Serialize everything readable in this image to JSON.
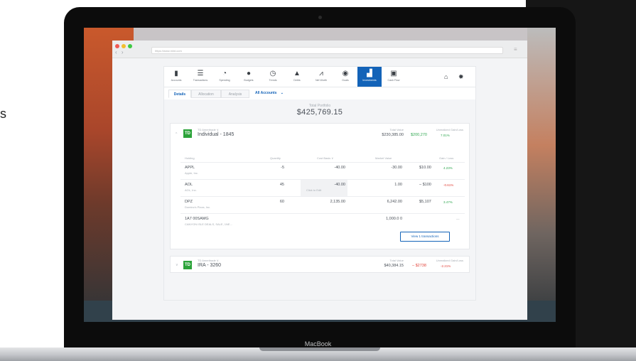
{
  "side_text": "s",
  "device_label": "MacBook",
  "browser": {
    "url": "https://www.mint.com",
    "back_glyph": "‹",
    "forward_glyph": "›",
    "menu_glyph": "≡"
  },
  "nav": {
    "items": [
      {
        "label": "Accounts",
        "icon": "wallet-icon",
        "glyph": "▮"
      },
      {
        "label": "Transactions",
        "icon": "list-icon",
        "glyph": "☰"
      },
      {
        "label": "Spending",
        "icon": "pie-icon",
        "glyph": "◔"
      },
      {
        "label": "Budgets",
        "icon": "coins-icon",
        "glyph": "●"
      },
      {
        "label": "Trends",
        "icon": "clock-icon",
        "glyph": "◷"
      },
      {
        "label": "Debts",
        "icon": "lock-icon",
        "glyph": "▲"
      },
      {
        "label": "Net Worth",
        "icon": "chart-line-icon",
        "glyph": "⩘"
      },
      {
        "label": "Goals",
        "icon": "target-icon",
        "glyph": "◉"
      },
      {
        "label": "Investments",
        "icon": "bar-chart-icon",
        "glyph": "▟",
        "active": true
      },
      {
        "label": "Cash Flow",
        "icon": "calendar-icon",
        "glyph": "▣"
      }
    ],
    "inbox_glyph": "⌂",
    "settings_glyph": "✹"
  },
  "tabs": [
    {
      "label": "Details",
      "active": true
    },
    {
      "label": "Allocation"
    },
    {
      "label": "Analysis"
    }
  ],
  "accounts_selector": {
    "label": "All Accounts",
    "chevron": "⌄"
  },
  "summary": {
    "label": "Total Portfolio",
    "value": "$425,769.15"
  },
  "accounts": [
    {
      "broker": "TD Ameritrade ∨",
      "name": "Individual - 1845",
      "logo": "TD",
      "total_label": "Total Value",
      "total_value": "$230,385.00",
      "gain_label": "Unrealized Gain/Loss",
      "gain_value": "$200,270",
      "gain_pct": "7.01%",
      "gain_color": "#32a852",
      "chevron": "^",
      "table": {
        "headers": [
          "Holding",
          "Quantity",
          "Cost Basis ∨",
          "Market Value",
          "Gain / Loss"
        ],
        "rows": [
          {
            "symbol": "APPL",
            "name": "Apple, Inc.",
            "quantity": "-5",
            "cost": "-40.00",
            "market": "-30.00",
            "gain": "$10.00",
            "gain_pct": "4.23%",
            "gain_color": "#32a852"
          },
          {
            "symbol": "AOL",
            "name": "AOL, Inc.",
            "quantity": "45",
            "cost": "-40.00",
            "market": "1.00",
            "gain": "– $100",
            "gain_pct": "-0.61%",
            "gain_color": "#e2453c",
            "edit_hint": "Click to Edit"
          },
          {
            "symbol": "DPZ",
            "name": "Domino's Pizza, Inc.",
            "quantity": "60",
            "cost": "2,135.00",
            "market": "6,242.00",
            "gain": "$5,107",
            "gain_pct": "3.47%",
            "gain_color": "#32a852"
          },
          {
            "symbol": "1A7 00SAMG",
            "name": "CANYON ISLE DEALS, SALE, 1NE...",
            "quantity": "",
            "cost": "",
            "market": "1,000.0 0",
            "gain": "",
            "gain_pct": "—",
            "gain_color": "#a5abb2"
          }
        ]
      },
      "view_button": "View 1 transactions"
    },
    {
      "broker": "TD Ameritrade ∨",
      "name": "IRA - 3260",
      "logo": "TD",
      "total_label": "Total Value",
      "total_value": "$40,384.15",
      "gain_label": "Unrealized Gain/Loss",
      "gain_value": "– $2738",
      "gain_pct": "-2.21%",
      "gain_color": "#e2453c",
      "chevron": "∨"
    }
  ]
}
